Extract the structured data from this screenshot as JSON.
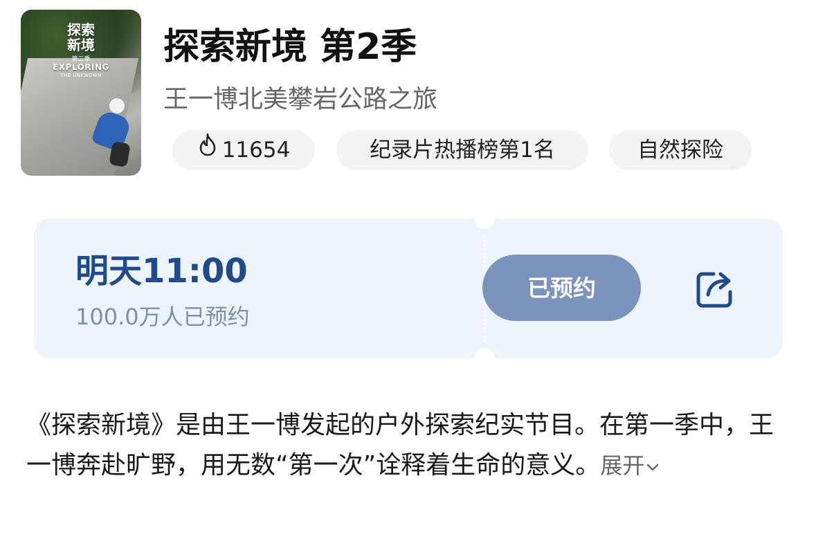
{
  "poster": {
    "title_line1": "探索",
    "title_line2": "新境",
    "season_label": "第二季",
    "english_title": "EXPLORING",
    "english_sub": "THE UNKNOWN"
  },
  "show": {
    "title": "探索新境 第2季",
    "subtitle": "王一博北美攀岩公路之旅"
  },
  "chips": {
    "hot_count": "11654",
    "rank": "纪录片热播榜第1名",
    "genre": "自然探险"
  },
  "reservation": {
    "time": "明天11:00",
    "count": "100.0万人已预约",
    "button_label": "已预约"
  },
  "description": {
    "text": "《探索新境》是由王一博发起的户外探索纪实节目。在第一季中，王一博奔赴旷野，用无数“第一次”诠释着生命的意义。",
    "expand_label": "展开"
  },
  "colors": {
    "accent_dark_blue": "#1f4a8e",
    "button_bg": "#7b94bd",
    "ticket_bg": "#eef4fc",
    "chip_bg": "#f3f3f3"
  },
  "icons": {
    "hot": "flame-icon",
    "share": "share-icon",
    "expand": "chevron-down-icon"
  }
}
